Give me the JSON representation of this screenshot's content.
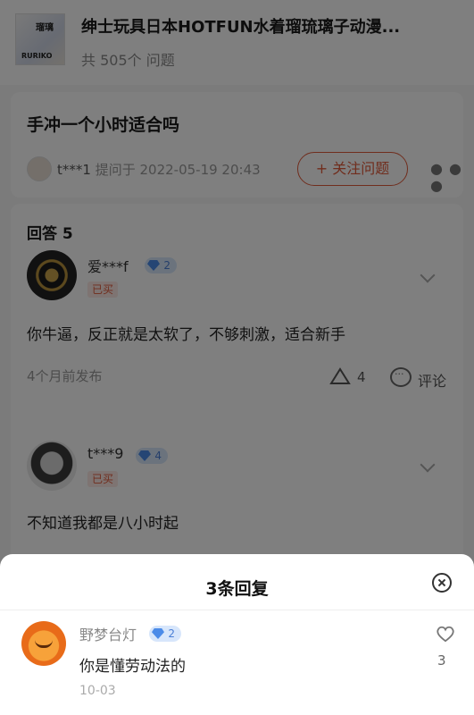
{
  "product": {
    "thumb_text_top": "瑠璃",
    "thumb_text_bottom": "RURIKO",
    "title": "绅士玩具日本HOTFUN水着瑠琉璃子动漫...",
    "question_count": "共 505个 问题"
  },
  "question": {
    "title": "手冲一个小时适合吗",
    "asker": "t***1",
    "asked_at": "提问于 2022-05-19 20:43",
    "follow_label": "+ 关注问题",
    "more_icon": "more-dots-icon"
  },
  "answers": {
    "header": "回答 5",
    "items": [
      {
        "name": "爱***f",
        "level": "2",
        "bought": "已买",
        "text": "你牛逼，反正就是太软了，不够刺激，适合新手",
        "time": "4个月前发布",
        "likes": "4",
        "comment_label": "评论"
      },
      {
        "name": "t***9",
        "level": "4",
        "bought": "已买",
        "text": "不知道我都是八小时起"
      }
    ]
  },
  "sheet": {
    "title": "3条回复",
    "reply": {
      "name": "野梦台灯",
      "level": "2",
      "text": "你是懂劳动法的",
      "time": "10-03",
      "likes": "3"
    }
  },
  "colors": {
    "accent": "#e05a3a",
    "vip_badge": "#4b8be8",
    "overlay": "rgba(0,0,0,0.5)"
  }
}
